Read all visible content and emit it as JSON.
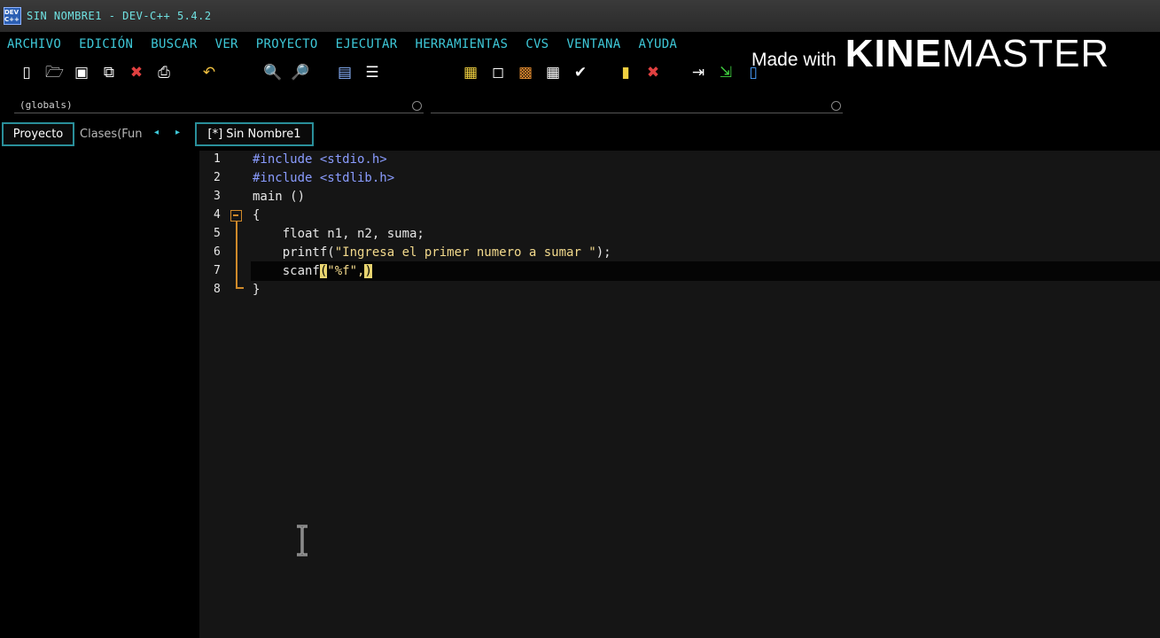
{
  "window": {
    "title": "SIN NOMBRE1 - DEV-C++ 5.4.2",
    "icon_text": "DEV C++"
  },
  "menu": [
    "ARCHIVO",
    "EDICIÓN",
    "BUSCAR",
    "VER",
    "PROYECTO",
    "EJECUTAR",
    "HERRAMIENTAS",
    "CVS",
    "VENTANA",
    "AYUDA"
  ],
  "watermark": {
    "made_with": "Made with",
    "brand_bold": "KINE",
    "brand": "MASTER"
  },
  "scope": {
    "left": "(globals)",
    "right": ""
  },
  "panels": {
    "project_tab": "Proyecto",
    "classes_tab": "Clases(Fun",
    "file_tab": "[*] Sin Nombre1"
  },
  "editor": {
    "line_numbers": [
      "1",
      "2",
      "3",
      "4",
      "5",
      "6",
      "7",
      "8"
    ],
    "lines": [
      {
        "pp": "#include <stdio.h>"
      },
      {
        "pp": "#include <stdlib.h>"
      },
      {
        "text": "main ()"
      },
      {
        "text": "{"
      },
      {
        "text": "    float n1, n2, suma;"
      },
      {
        "pre": "    printf(",
        "str": "\"Ingresa el primer numero a sumar \"",
        "post": ");"
      },
      {
        "pre": "    scanf",
        "hl1": "(",
        "str": "\"%f\",",
        "hl2": ")"
      },
      {
        "text": "}"
      }
    ]
  },
  "colors": {
    "accent": "#3ec8d8",
    "preprocessor": "#8a9cff",
    "string": "#f2d98c",
    "brace_highlight": "#e8d470",
    "fold": "#d08a2a"
  }
}
